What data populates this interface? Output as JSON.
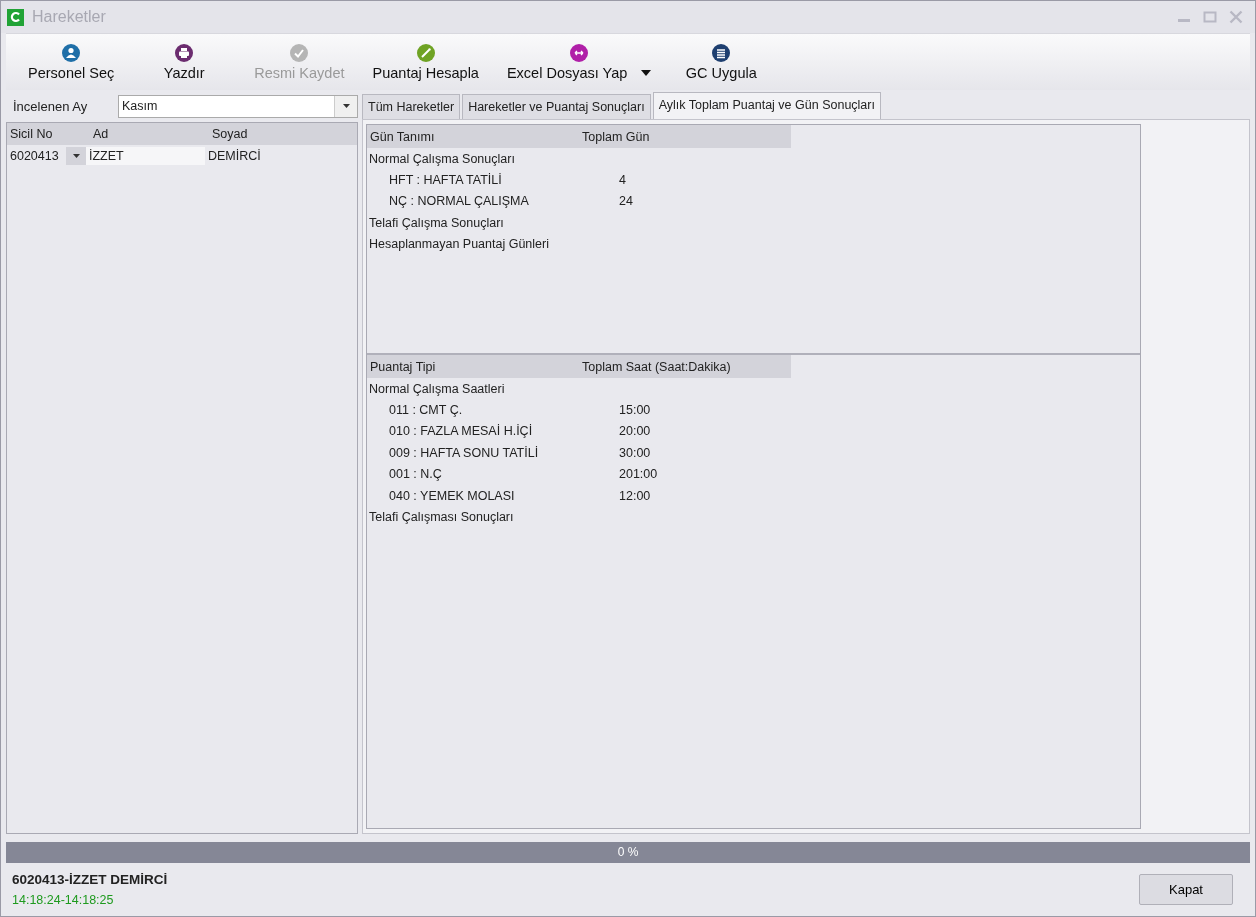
{
  "window": {
    "title": "Hareketler"
  },
  "toolbar": [
    {
      "label": "Personel Seç",
      "kind": "person",
      "color": "#1f6fa8",
      "disabled": false,
      "dropdown": false
    },
    {
      "label": "Yazdır",
      "kind": "printer",
      "color": "#6b2c6f",
      "disabled": false,
      "dropdown": false
    },
    {
      "label": "Resmi Kaydet",
      "kind": "check",
      "color": "#b5b5b5",
      "disabled": true,
      "dropdown": false
    },
    {
      "label": "Puantaj Hesapla",
      "kind": "wand",
      "color": "#6fa324",
      "disabled": false,
      "dropdown": false
    },
    {
      "label": "Excel Dosyası Yap",
      "kind": "arrows",
      "color": "#b01fa8",
      "disabled": false,
      "dropdown": true
    },
    {
      "label": "GC Uygula",
      "kind": "list",
      "color": "#1e3f70",
      "disabled": false,
      "dropdown": false
    }
  ],
  "month_filter": {
    "label": "İncelenen Ay",
    "value": "Kasım"
  },
  "personnel_table": {
    "columns": [
      "Sicil No",
      "Ad",
      "Soyad"
    ],
    "rows": [
      {
        "sicil_no": "6020413",
        "ad": "İZZET",
        "soyad": "DEMİRCİ"
      }
    ]
  },
  "tabs": [
    {
      "label": "Tüm Hareketler",
      "selected": false
    },
    {
      "label": "Hareketler ve Puantaj Sonuçları",
      "selected": false
    },
    {
      "label": "Aylık Toplam Puantaj  ve Gün Sonuçları",
      "selected": true
    }
  ],
  "day_grid": {
    "columns": [
      "Gün Tanımı",
      "Toplam Gün"
    ],
    "rows": [
      {
        "label": "Normal Çalışma Sonuçları",
        "children": [
          {
            "label": "HFT : HAFTA TATİLİ",
            "value": "4"
          },
          {
            "label": "NÇ : NORMAL ÇALIŞMA",
            "value": "24"
          }
        ]
      },
      {
        "label": "Telafi Çalışma Sonuçları"
      },
      {
        "label": "Hesaplanmayan Puantaj Günleri"
      }
    ]
  },
  "hour_grid": {
    "columns": [
      "Puantaj Tipi",
      "Toplam Saat (Saat:Dakika)"
    ],
    "rows": [
      {
        "label": "Normal Çalışma Saatleri",
        "children": [
          {
            "label": "011 : CMT Ç.",
            "value": "15:00"
          },
          {
            "label": "010 : FAZLA MESAİ H.İÇİ",
            "value": "20:00"
          },
          {
            "label": "009 : HAFTA SONU TATİLİ",
            "value": "30:00"
          },
          {
            "label": "001 : N.Ç",
            "value": "201:00"
          },
          {
            "label": "040 : YEMEK MOLASI",
            "value": "12:00"
          }
        ]
      },
      {
        "label": "Telafi Çalışması Sonuçları"
      }
    ]
  },
  "progress": {
    "level": 0,
    "text": "0 %"
  },
  "status": {
    "person": "6020413-İZZET DEMİRCİ",
    "time": "14:18:24-14:18:25"
  },
  "close_button": "Kapat"
}
